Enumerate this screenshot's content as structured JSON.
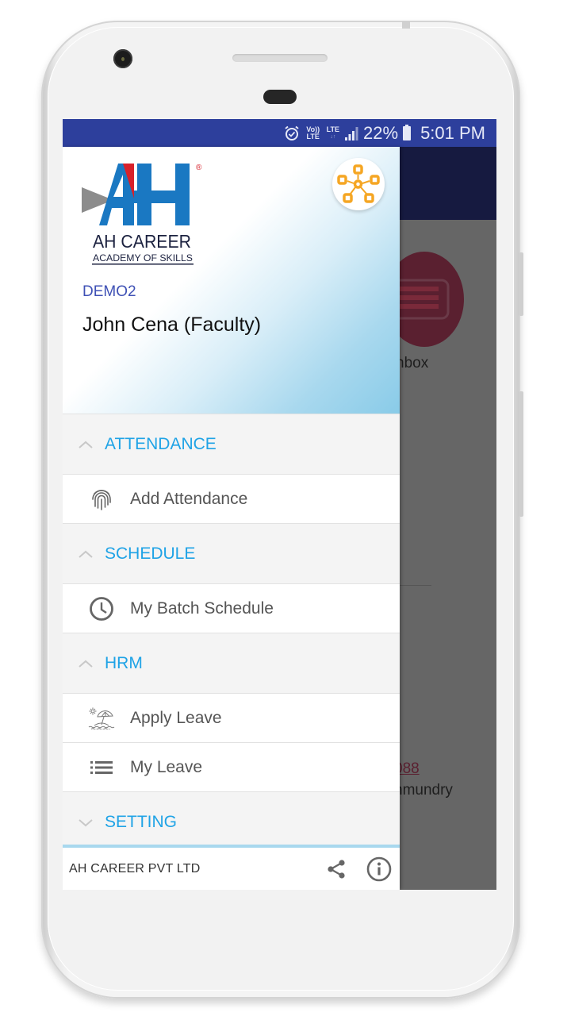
{
  "status_bar": {
    "volte_label": "Vo)) LTE",
    "lte_label": "LTE",
    "battery_percent": "22%",
    "time": "5:01 PM",
    "icons": [
      "alarm-icon",
      "volte-icon",
      "lte-icon",
      "signal-icon",
      "battery-icon"
    ]
  },
  "drawer": {
    "logo": {
      "mark": "AH",
      "title": "AH CAREER",
      "subtitle": "ACADEMY OF SKILLS",
      "registered": "®"
    },
    "organization": "DEMO2",
    "user_name": "John Cena (Faculty)",
    "switch_icon": "network-hub-icon",
    "sections": [
      {
        "label": "ATTENDANCE",
        "expanded": true,
        "items": [
          {
            "label": "Add Attendance",
            "icon": "fingerprint-icon"
          }
        ]
      },
      {
        "label": "SCHEDULE",
        "expanded": true,
        "items": [
          {
            "label": "My Batch Schedule",
            "icon": "clock-icon"
          }
        ]
      },
      {
        "label": "HRM",
        "expanded": true,
        "items": [
          {
            "label": "Apply Leave",
            "icon": "beach-umbrella-icon"
          },
          {
            "label": "My Leave",
            "icon": "list-icon"
          }
        ]
      },
      {
        "label": "SETTING",
        "expanded": false,
        "items": []
      }
    ],
    "footer": {
      "company": "AH CAREER PVT LTD",
      "share_icon": "share-icon",
      "info_icon": "info-icon"
    }
  },
  "background_app": {
    "inbox_label": "nbox",
    "link_text": "088",
    "city_text": "nmundry"
  },
  "colors": {
    "status_bar": "#2d3f9c",
    "section_label": "#1fa3e6",
    "org_label": "#3f51b5",
    "logo_blue": "#1a78c2",
    "logo_red": "#d7212b",
    "accent_orange": "#f5a623"
  }
}
